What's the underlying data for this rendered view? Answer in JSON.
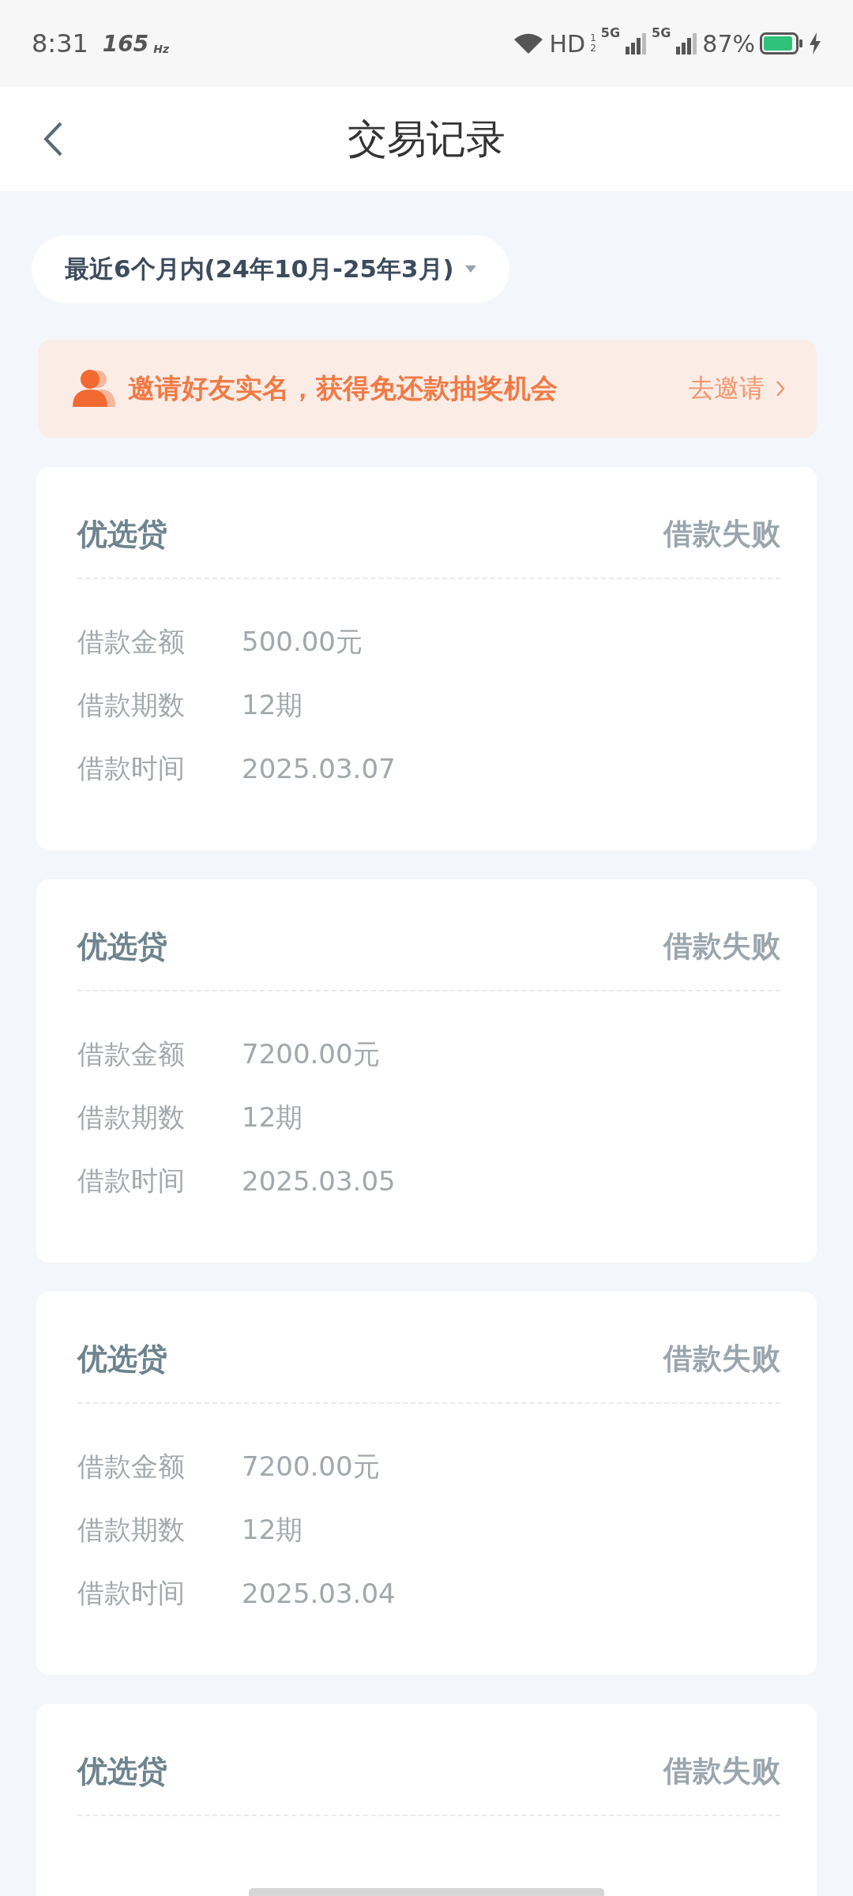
{
  "status_bar": {
    "time": "8:31",
    "refresh_rate": "165",
    "refresh_unit": "Hz",
    "network": "HD",
    "network_sub": [
      "1",
      "2"
    ],
    "sims": [
      "5G",
      "5G"
    ],
    "battery": "87%"
  },
  "header": {
    "title": "交易记录"
  },
  "filter": {
    "label": "最近6个月内(24年10月-25年3月)"
  },
  "banner": {
    "text": "邀请好友实名，获得免还款抽奖机会",
    "action": "去邀请"
  },
  "records": [
    {
      "product": "优选贷",
      "status": "借款失败",
      "fields": [
        {
          "label": "借款金额",
          "value": "500.00元"
        },
        {
          "label": "借款期数",
          "value": "12期"
        },
        {
          "label": "借款时间",
          "value": "2025.03.07"
        }
      ]
    },
    {
      "product": "优选贷",
      "status": "借款失败",
      "fields": [
        {
          "label": "借款金额",
          "value": "7200.00元"
        },
        {
          "label": "借款期数",
          "value": "12期"
        },
        {
          "label": "借款时间",
          "value": "2025.03.05"
        }
      ]
    },
    {
      "product": "优选贷",
      "status": "借款失败",
      "fields": [
        {
          "label": "借款金额",
          "value": "7200.00元"
        },
        {
          "label": "借款期数",
          "value": "12期"
        },
        {
          "label": "借款时间",
          "value": "2025.03.04"
        }
      ]
    },
    {
      "product": "优选贷",
      "status": "借款失败"
    }
  ]
}
